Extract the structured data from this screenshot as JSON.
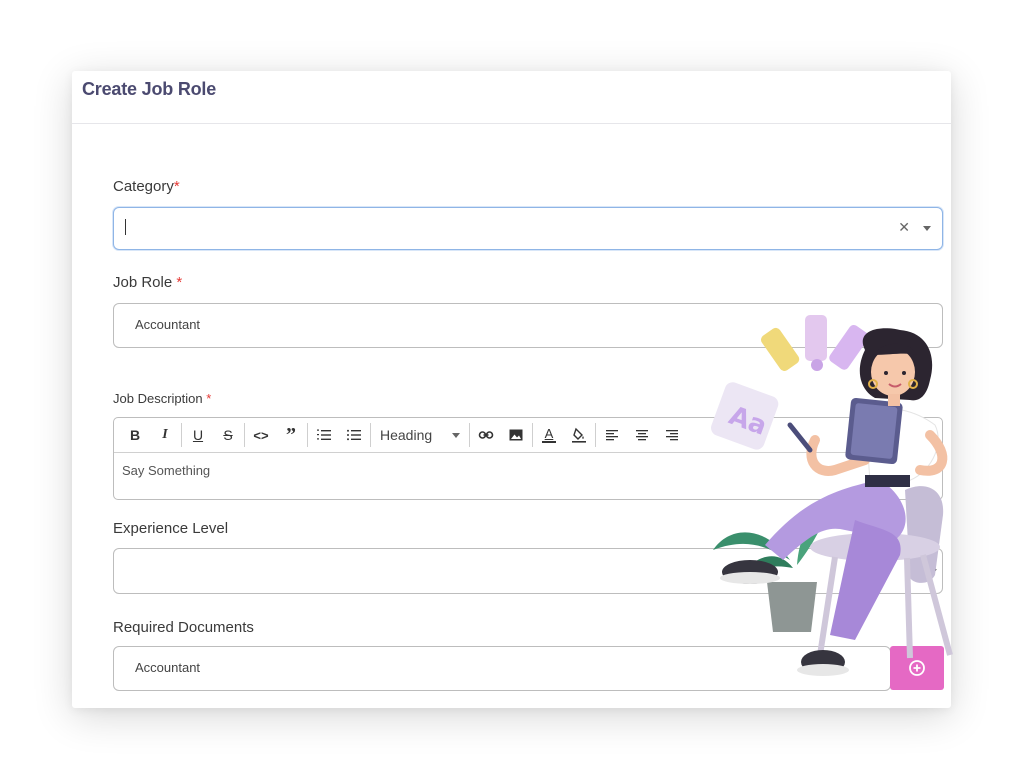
{
  "header": {
    "title": "Create Job Role"
  },
  "form": {
    "category": {
      "label": "Category",
      "required_mark": "*",
      "value": ""
    },
    "job_role": {
      "label": "Job Role",
      "required_mark": "*",
      "value": "Accountant"
    },
    "job_description": {
      "label": "Job Description",
      "required_mark": "*",
      "placeholder": "Say Something",
      "toolbar": {
        "bold": "B",
        "italic": "I",
        "underline": "U",
        "strike": "S",
        "code": "<>",
        "quote": "”",
        "heading": "Heading",
        "color_letter": "A"
      }
    },
    "experience_level": {
      "label": "Experience Level",
      "value": ""
    },
    "required_documents": {
      "label": "Required Documents",
      "value": "Accountant"
    }
  },
  "icons": {
    "clear": "close-icon",
    "add": "plus-circle-icon"
  },
  "colors": {
    "title": "#4b4a70",
    "required": "#e53935",
    "add_button": "#e569c4",
    "focus_border": "#8fb5e6"
  }
}
